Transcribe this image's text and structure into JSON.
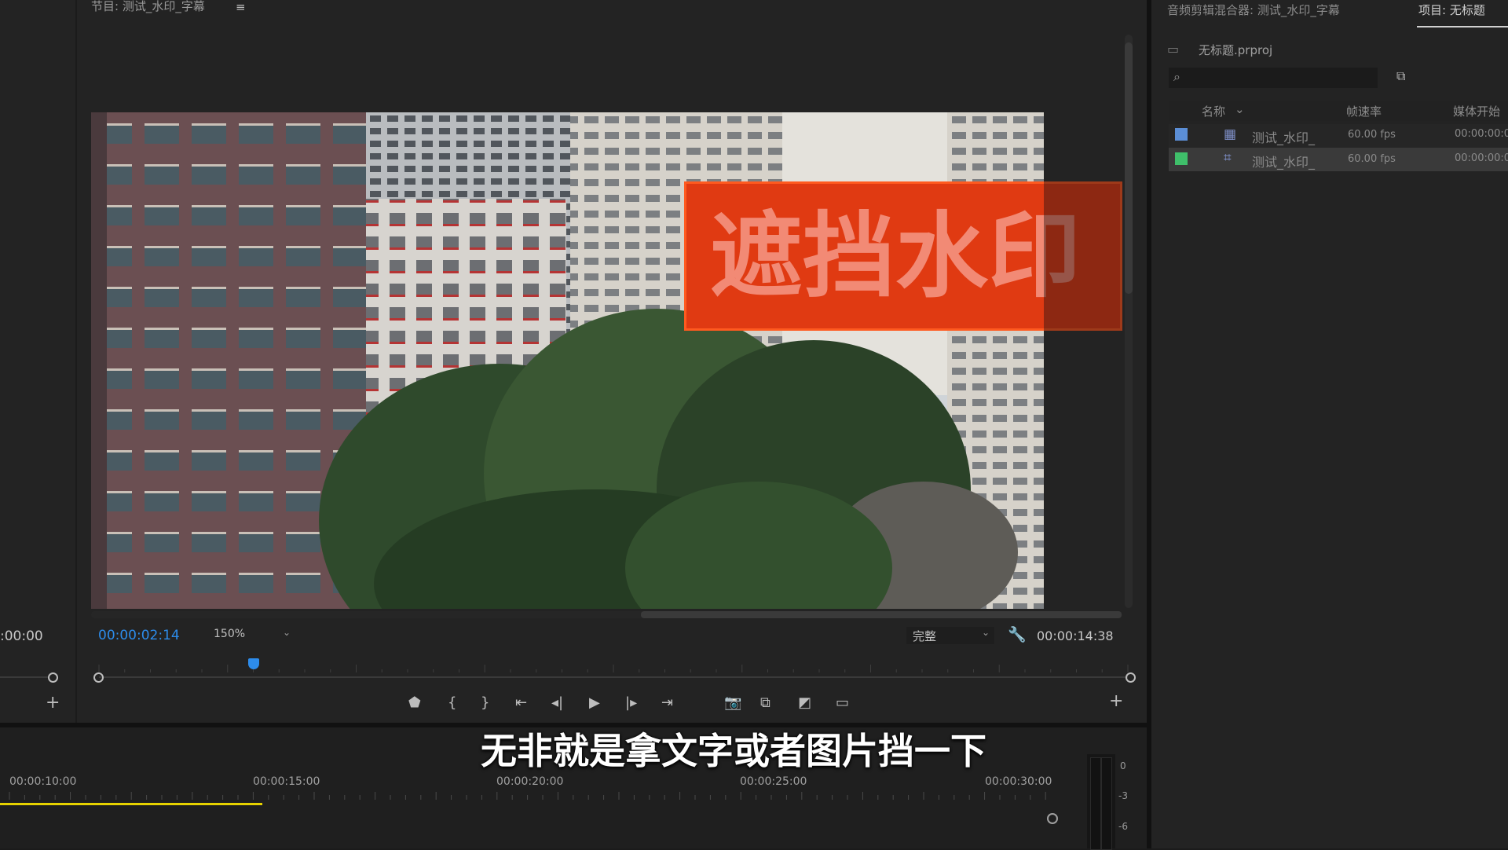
{
  "program_monitor": {
    "title": "节目: 测试_水印_字幕",
    "menu_icon": "hamburger-menu-icon",
    "timecode_current": "00:00:02:14",
    "zoom": "150%",
    "quality": "完整",
    "timecode_duration": "00:00:14:38",
    "playhead_fraction": 0.15,
    "controls": [
      "marker-icon",
      "mark-in-icon",
      "mark-out-icon",
      "go-to-in-icon",
      "step-back-icon",
      "play-icon",
      "step-forward-icon",
      "go-to-out-icon",
      "export-frame-icon",
      "insert-icon",
      "overwrite-icon",
      "safe-margins-icon"
    ]
  },
  "video": {
    "overlay_text": "遮挡水印",
    "overlay_color": "#e03a12"
  },
  "source_monitor": {
    "timecode": ":00:00"
  },
  "subtitle": "无非就是拿文字或者图片挡一下",
  "timeline": {
    "ruler_labels": [
      "00:00:10:00",
      "00:00:15:00",
      "00:00:20:00",
      "00:00:25:00",
      "00:00:30:00"
    ],
    "work_area_color": "#e6d200",
    "meter_labels": [
      "0",
      "-3",
      "-6"
    ]
  },
  "right_panel": {
    "tabs": [
      "音频剪辑混合器: 测试_水印_字幕",
      "项目: 无标题"
    ],
    "project_file": "无标题.prproj",
    "search_placeholder": "",
    "columns": [
      "名称",
      "帧速率",
      "媒体开始"
    ],
    "rows": [
      {
        "name": "测试_水印_",
        "fps": "60.00 fps",
        "start": "00:00:00:0",
        "label_color": "#5b8ed6",
        "icon": "sequence-icon"
      },
      {
        "name": "测试_水印_",
        "fps": "60.00 fps",
        "start": "00:00:00:0",
        "label_color": "#3fbf6a",
        "icon": "multicam-clip-icon"
      }
    ]
  }
}
